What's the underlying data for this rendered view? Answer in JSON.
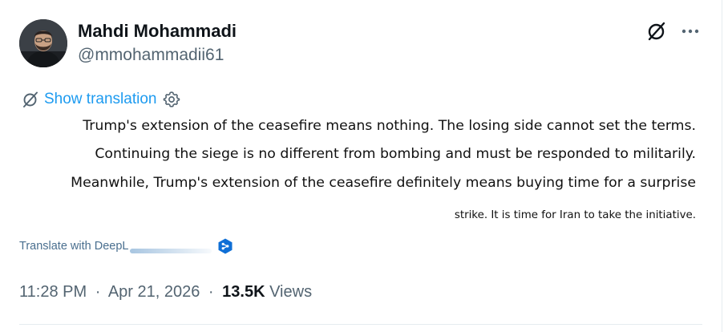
{
  "author": {
    "name": "Mahdi Mohammadi",
    "handle": "@mmohammadii61",
    "avatar_icon": "profile-photo"
  },
  "header_actions": {
    "grok_icon": "grok-slash-circle-icon",
    "more_icon": "more-dots-icon"
  },
  "translation": {
    "icon": "grok-slash-circle-icon",
    "label": "Show translation",
    "settings_icon": "gear-icon"
  },
  "tweet": {
    "lines": [
      "Trump's extension of the ceasefire means nothing. The losing side cannot set the terms.",
      "Continuing the siege is no different from bombing and must be responded to militarily.",
      "Meanwhile, Trump's extension of the ceasefire definitely means buying time for a surprise",
      "strike. It is time for Iran to take the initiative."
    ]
  },
  "deepl": {
    "label": "Translate with DeepL",
    "logo_icon": "deepl-logo-icon"
  },
  "meta": {
    "time": "11:28 PM",
    "separator": "·",
    "date": "Apr 21, 2026",
    "views_count": "13.5K",
    "views_label": "Views"
  },
  "colors": {
    "link_blue": "#1d9bf0",
    "secondary_text": "#536471",
    "primary_text": "#0f1419",
    "deepl_blue": "#0f6fd6"
  }
}
